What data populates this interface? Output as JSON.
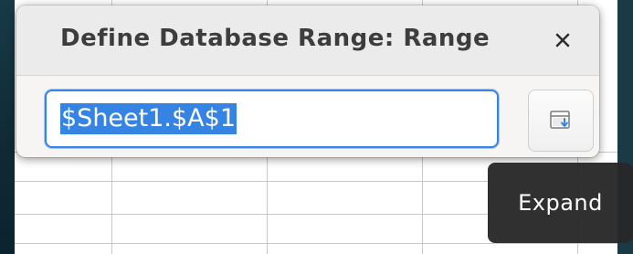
{
  "dialog": {
    "title": "Define Database Range: Range",
    "range_value": "$Sheet1.$A$1",
    "close_icon": "close-icon",
    "shrink_button_icon": "expand-dialog-icon",
    "accent_color": "#3584e4"
  },
  "tooltip": {
    "text": "Expand"
  }
}
